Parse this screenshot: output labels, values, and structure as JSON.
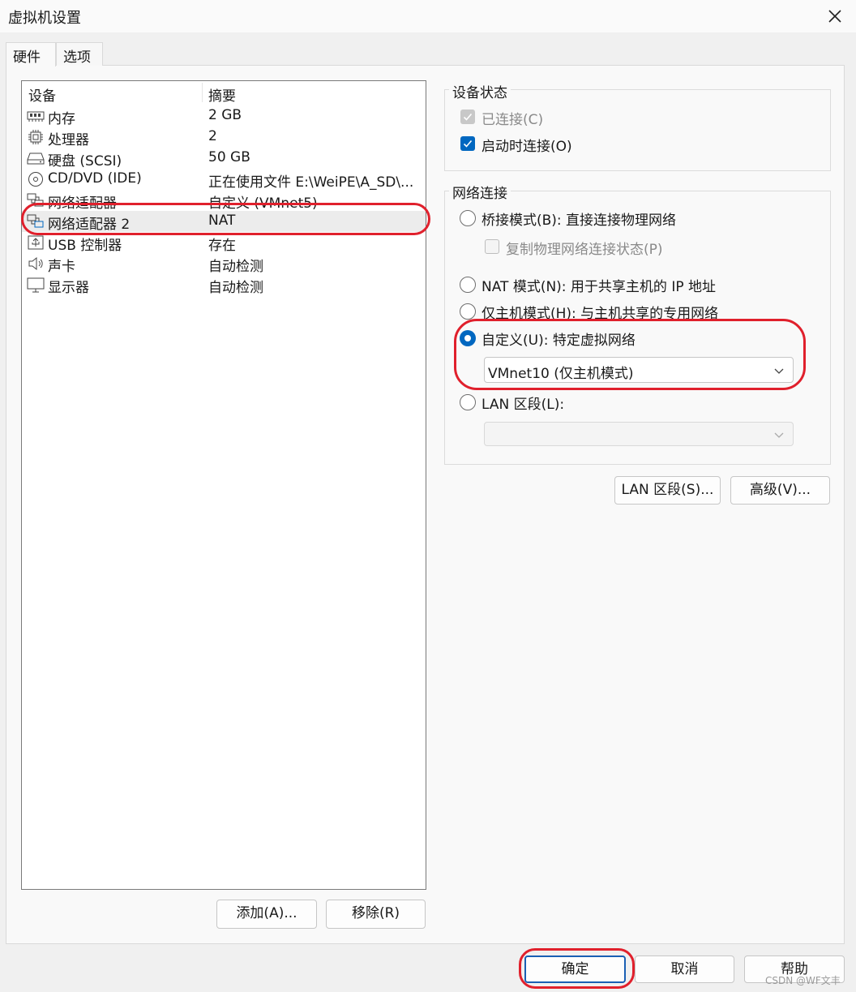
{
  "window": {
    "title": "虚拟机设置"
  },
  "tabs": [
    {
      "label": "硬件",
      "active": true
    },
    {
      "label": "选项",
      "active": false
    }
  ],
  "device_list": {
    "col_device": "设备",
    "col_summary": "摘要",
    "rows": [
      {
        "icon": "memory-icon",
        "name": "内存",
        "summary": "2 GB"
      },
      {
        "icon": "cpu-icon",
        "name": "处理器",
        "summary": "2"
      },
      {
        "icon": "hard-disk-icon",
        "name": "硬盘 (SCSI)",
        "summary": "50 GB"
      },
      {
        "icon": "cd-dvd-icon",
        "name": "CD/DVD (IDE)",
        "summary": "正在使用文件 E:\\WeiPE\\A_SD\\..."
      },
      {
        "icon": "network-adapter-icon",
        "name": "网络适配器",
        "summary": "自定义 (VMnet5)"
      },
      {
        "icon": "network-adapter-icon",
        "name": "网络适配器 2",
        "summary": "NAT",
        "selected": true
      },
      {
        "icon": "usb-icon",
        "name": "USB 控制器",
        "summary": "存在"
      },
      {
        "icon": "speaker-icon",
        "name": "声卡",
        "summary": "自动检测"
      },
      {
        "icon": "monitor-icon",
        "name": "显示器",
        "summary": "自动检测"
      }
    ],
    "add_button": "添加(A)...",
    "remove_button": "移除(R)"
  },
  "device_status": {
    "label": "设备状态",
    "connected": {
      "label": "已连接(C)",
      "checked": true,
      "disabled": true
    },
    "connect_at_power_on": {
      "label": "启动时连接(O)",
      "checked": true
    }
  },
  "network_connection": {
    "label": "网络连接",
    "bridged": {
      "label": "桥接模式(B): 直接连接物理网络",
      "selected": false
    },
    "replicate_state": {
      "label": "复制物理网络连接状态(P)",
      "checked": false,
      "disabled": true
    },
    "nat": {
      "label": "NAT 模式(N): 用于共享主机的 IP 地址",
      "selected": false
    },
    "host_only": {
      "label": "仅主机模式(H): 与主机共享的专用网络",
      "selected": false
    },
    "custom": {
      "label": "自定义(U): 特定虚拟网络",
      "selected": true
    },
    "custom_select_value": "VMnet10 (仅主机模式)",
    "lan_segment": {
      "label": "LAN 区段(L):",
      "selected": false
    },
    "lan_select_value": ""
  },
  "side_buttons": {
    "lan_segments": "LAN 区段(S)...",
    "advanced": "高级(V)..."
  },
  "footer": {
    "ok": "确定",
    "cancel": "取消",
    "help": "帮助"
  },
  "watermark": "CSDN @WF文丰",
  "colors": {
    "accent": "#0067c0",
    "annotation": "#e0202c"
  }
}
